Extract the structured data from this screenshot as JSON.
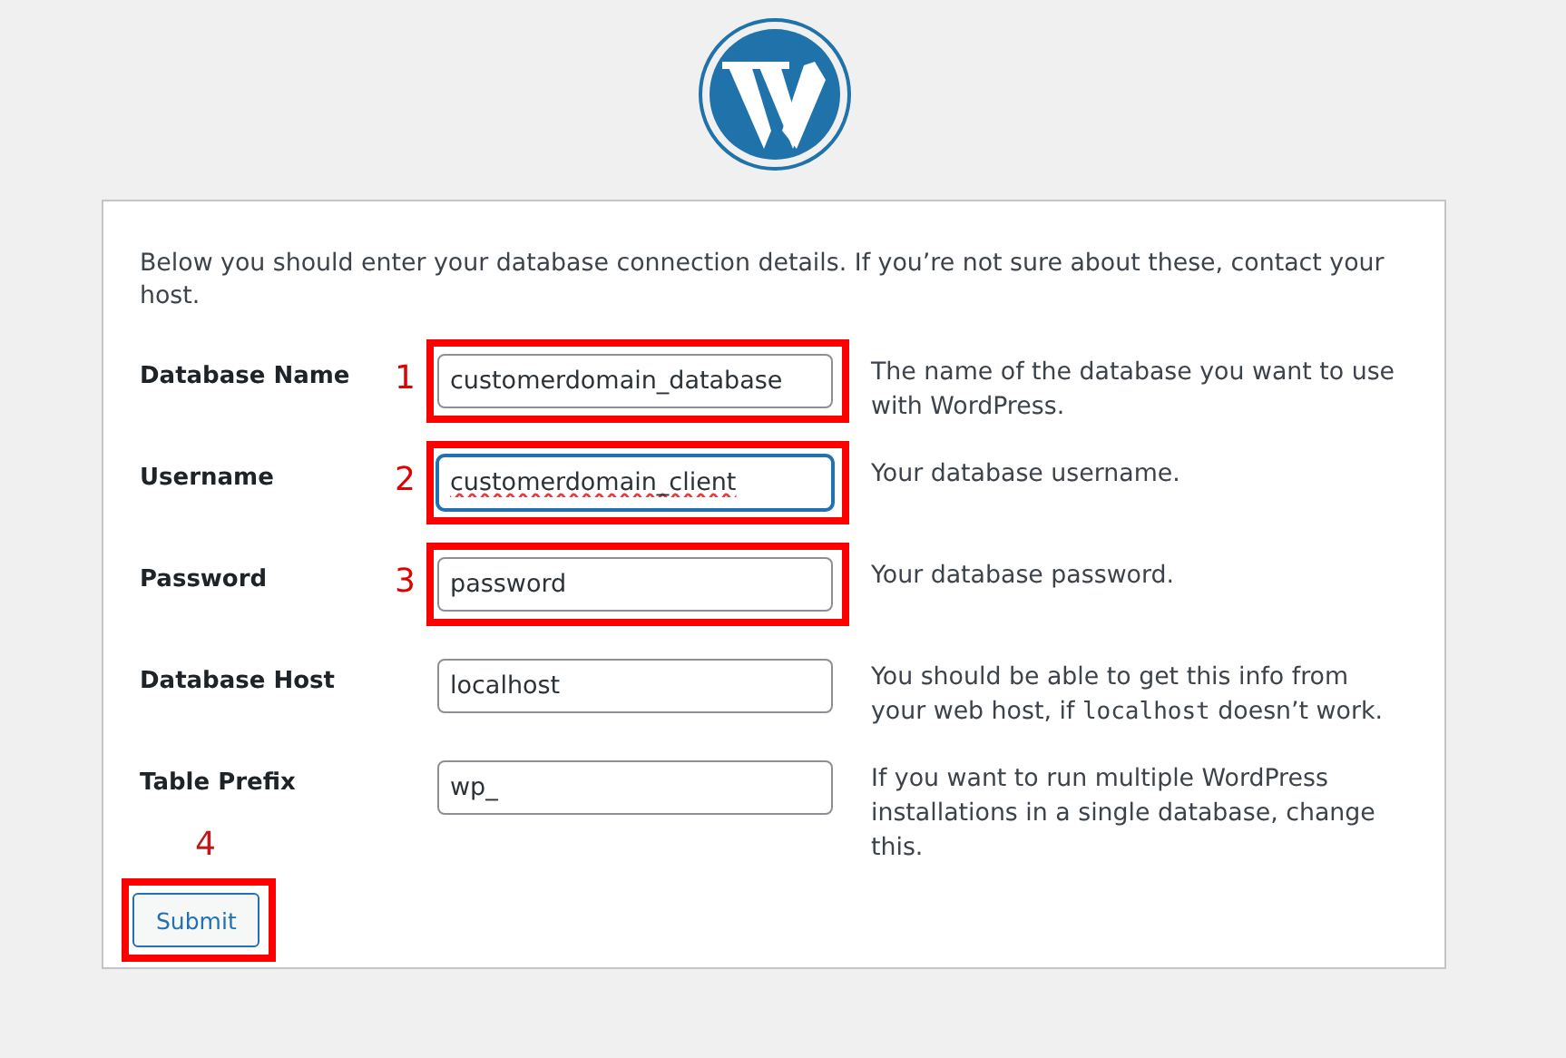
{
  "intro": "Below you should enter your database connection details. If you’re not sure about these, contact your host.",
  "fields": [
    {
      "label": "Database Name",
      "value": "customerdomain_database",
      "annotation": "1",
      "highlighted": true,
      "focused": false,
      "misspelled": false,
      "description": [
        {
          "kind": "text",
          "text": "The name of the database you want to use with WordPress."
        }
      ]
    },
    {
      "label": "Username",
      "value": "customerdomain_client",
      "annotation": "2",
      "highlighted": true,
      "focused": true,
      "misspelled": true,
      "description": [
        {
          "kind": "text",
          "text": "Your database username."
        }
      ]
    },
    {
      "label": "Password",
      "value": "password",
      "annotation": "3",
      "highlighted": true,
      "focused": false,
      "misspelled": false,
      "description": [
        {
          "kind": "text",
          "text": "Your database password."
        }
      ]
    },
    {
      "label": "Database Host",
      "value": "localhost",
      "highlighted": false,
      "focused": false,
      "misspelled": false,
      "description": [
        {
          "kind": "text",
          "text": "You should be able to get this info from your web host, if "
        },
        {
          "kind": "code",
          "text": "localhost"
        },
        {
          "kind": "text",
          "text": " doesn’t work."
        }
      ]
    },
    {
      "label": "Table Prefix",
      "value": "wp_",
      "highlighted": false,
      "focused": false,
      "misspelled": false,
      "description": [
        {
          "kind": "text",
          "text": "If you want to run multiple WordPress installations in a single database, change this."
        }
      ]
    }
  ],
  "submit": {
    "label": "Submit",
    "annotation": "4",
    "highlighted": true
  }
}
